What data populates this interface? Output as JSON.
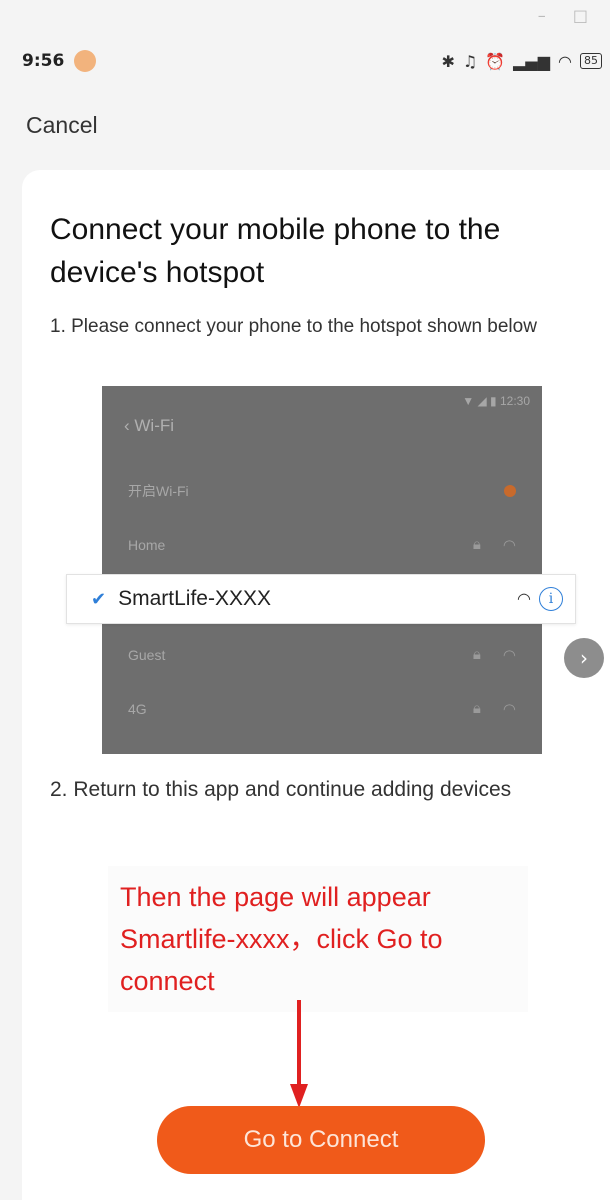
{
  "window_controls": {
    "minimize": "–",
    "maximize": "□"
  },
  "status_bar": {
    "time": "9:56",
    "icons": [
      "bluetooth-icon",
      "mute-icon",
      "alarm-icon",
      "signal-icon",
      "wifi-icon"
    ],
    "battery": "85"
  },
  "nav": {
    "cancel_label": "Cancel"
  },
  "main": {
    "title": "Connect your mobile phone to the device's hotspot",
    "step1": "1. Please connect your phone to the hotspot shown below",
    "step2": "2. Return to this app and continue adding devices",
    "annotation": "Then the page will appear Smartlife-xxxx，click Go to connect",
    "connect_button": "Go to Connect"
  },
  "wifi_screenshot": {
    "status_time": "12:30",
    "header": "Wi-Fi",
    "toggle_label": "开启Wi-Fi",
    "networks": [
      {
        "name": "Home"
      },
      {
        "name": "SmartLife-XXXX",
        "selected": true
      },
      {
        "name": "Guest"
      },
      {
        "name": "4G"
      }
    ]
  },
  "colors": {
    "accent": "#f05a1a",
    "annotation": "#e02020",
    "check": "#2f7fd8"
  }
}
